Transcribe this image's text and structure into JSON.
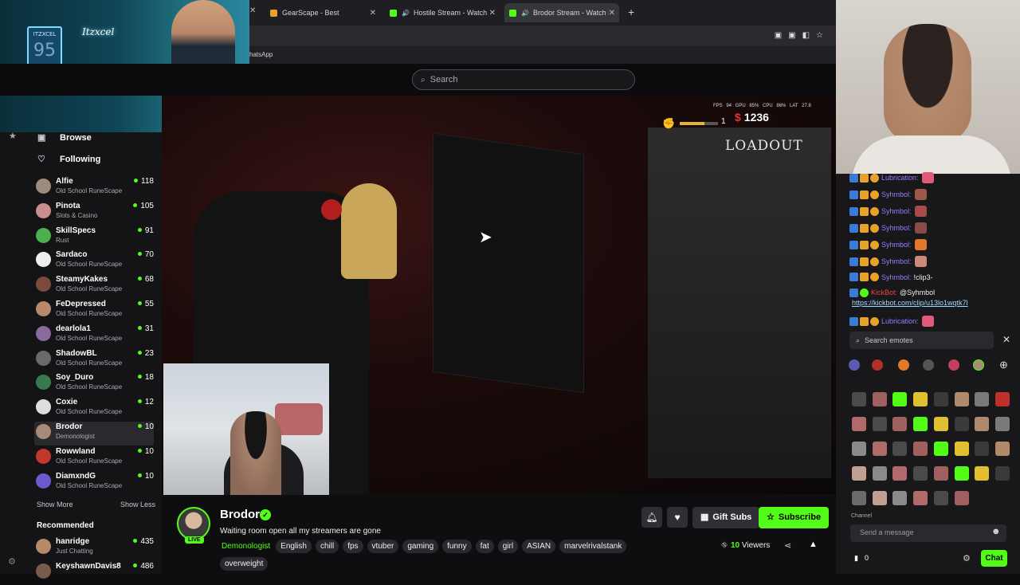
{
  "webcam_left": {
    "neon_text": "Itzxcel",
    "sign_text": "ITZXCEL",
    "sign_big": "95"
  },
  "browser": {
    "tabs": [
      {
        "label": "GearScape - Best",
        "favicon_color": "#e8a22a"
      },
      {
        "label": "Hostile Stream - Watch Live",
        "favicon_color": "#53fc18"
      },
      {
        "label": "Brodor Stream - Watch Live",
        "favicon_color": "#53fc18"
      }
    ],
    "new_tab_label": "+",
    "bookmark": "hatsApp"
  },
  "search": {
    "placeholder": "Search"
  },
  "nav": {
    "browse": "Browse",
    "following": "Following"
  },
  "following": [
    {
      "name": "Alfie",
      "game": "Old School RuneScape",
      "viewers": "118",
      "color": "#9b8b7a"
    },
    {
      "name": "Pinota",
      "game": "Slots & Casino",
      "viewers": "105",
      "color": "#c98f8f"
    },
    {
      "name": "SkillSpecs",
      "game": "Rust",
      "viewers": "91",
      "color": "#4caf50"
    },
    {
      "name": "Sardaco",
      "game": "Old School RuneScape",
      "viewers": "70",
      "color": "#eeeeee"
    },
    {
      "name": "SteamyKakes",
      "game": "Old School RuneScape",
      "viewers": "68",
      "color": "#7a4a3a"
    },
    {
      "name": "FeDepressed",
      "game": "Old School RuneScape",
      "viewers": "55",
      "color": "#b88a6a"
    },
    {
      "name": "dearlola1",
      "game": "Old School RuneScape",
      "viewers": "31",
      "color": "#8a6a9a"
    },
    {
      "name": "ShadowBL",
      "game": "Old School RuneScape",
      "viewers": "23",
      "color": "#6a6a6a"
    },
    {
      "name": "Soy_Duro",
      "game": "Old School RuneScape",
      "viewers": "18",
      "color": "#3a7a4a"
    },
    {
      "name": "Coxie",
      "game": "Old School RuneScape",
      "viewers": "12",
      "color": "#dddddd"
    },
    {
      "name": "Brodor",
      "game": "Demonologist",
      "viewers": "10",
      "color": "#a88a78"
    },
    {
      "name": "Rowwland",
      "game": "Old School RuneScape",
      "viewers": "10",
      "color": "#c0392b"
    },
    {
      "name": "DiamxndG",
      "game": "Old School RuneScape",
      "viewers": "10",
      "color": "#6a5acd"
    }
  ],
  "show_more": "Show More",
  "show_less": "Show Less",
  "recommended_heading": "Recommended",
  "recommended": [
    {
      "name": "hanridge",
      "game": "Just Chatting",
      "viewers": "435",
      "color": "#b58a6a"
    },
    {
      "name": "KeyshawnDavis8",
      "game": "",
      "viewers": "486",
      "color": "#7a5a4a"
    }
  ],
  "game_hud": {
    "loadout": "LOADOUT",
    "money": "1236",
    "level": "1",
    "health_fraction": 0.65,
    "stats": "FPS 94   GPU 85%   CPU 86%   LAT 27.8"
  },
  "stream": {
    "streamer": "Brodor",
    "live_label": "LIVE",
    "title": "Waiting room open all my streamers are gone",
    "category": "Demonologist",
    "tags": [
      "English",
      "chill",
      "fps",
      "vtuber",
      "gaming",
      "funny",
      "fat",
      "girl",
      "ASIAN",
      "marvelrivalstank",
      "overweight"
    ],
    "viewer_count": "10",
    "viewers_label": "Viewers",
    "gift_label": "Gift Subs",
    "subscribe_label": "Subscribe"
  },
  "chat": {
    "messages": [
      {
        "user": "Lubrication:",
        "text": "",
        "emote_color": "#e05a7a"
      },
      {
        "user": "Syhmbol:",
        "text": "",
        "emote_color": "#9a5a4a"
      },
      {
        "user": "Syhmbol:",
        "text": "",
        "emote_color": "#a84a4a"
      },
      {
        "user": "Syhmbol:",
        "text": "",
        "emote_color": "#8a4a4a"
      },
      {
        "user": "Syhmbol:",
        "text": "",
        "emote_color": "#e07a2a"
      },
      {
        "user": "Syhmbol:",
        "text": "",
        "emote_color": "#c98a7a"
      },
      {
        "user": "Syhmbol:",
        "text": "!clip3-",
        "emote_color": ""
      }
    ],
    "bot_user": "KickBot:",
    "bot_text": "@Syhmbol",
    "bot_link": "https://kickbot.com/clip/u13lo1wqtk7l",
    "last_user": "Lubrication:",
    "emote_search_placeholder": "Search emotes",
    "emote_section_label": "Channel",
    "input_placeholder": "Send a message",
    "points": "0",
    "send_label": "Chat"
  }
}
